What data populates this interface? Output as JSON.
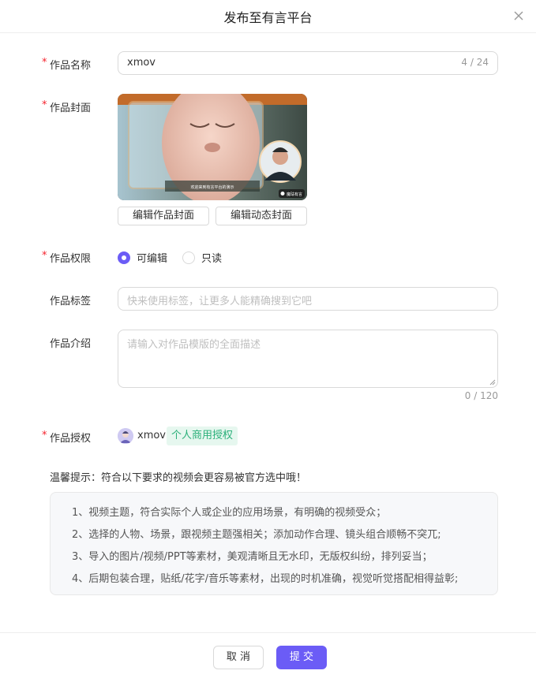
{
  "dialog": {
    "title": "发布至有言平台"
  },
  "form": {
    "name": {
      "label": "作品名称",
      "value": "xmov",
      "count": "4 / 24"
    },
    "cover": {
      "label": "作品封面",
      "subtitle_text": "欢迎来到有言平台的演示",
      "watermark_text": "魔珐有言",
      "edit_cover_button": "编辑作品封面",
      "edit_dynamic_cover_button": "编辑动态封面"
    },
    "permission": {
      "label": "作品权限",
      "options": [
        "可编辑",
        "只读"
      ],
      "selected": "可编辑"
    },
    "tags": {
      "label": "作品标签",
      "placeholder": "快来使用标签，让更多人能精确搜到它吧"
    },
    "intro": {
      "label": "作品介绍",
      "placeholder": "请输入对作品模版的全面描述",
      "count": "0 / 120"
    },
    "license": {
      "label": "作品授权",
      "user": "xmov",
      "badge": "个人商用授权"
    }
  },
  "tips": {
    "title": "温馨提示：符合以下要求的视频会更容易被官方选中哦！",
    "items": [
      "1、视频主题，符合实际个人或企业的应用场景，有明确的视频受众；",
      "2、选择的人物、场景，跟视频主题强相关；添加动作合理、镜头组合顺畅不突兀;",
      "3、导入的图片/视频/PPT等素材，美观清晰且无水印，无版权纠纷，排列妥当；",
      "4、后期包装合理，贴纸/花字/音乐等素材，出现的时机准确，视觉听觉搭配相得益彰;"
    ]
  },
  "footer": {
    "cancel": "取 消",
    "submit": "提 交"
  },
  "colors": {
    "primary": "#6b5cf6",
    "required": "#f5222d",
    "badge_bg": "#e6f7ef",
    "badge_text": "#2bb07a"
  }
}
